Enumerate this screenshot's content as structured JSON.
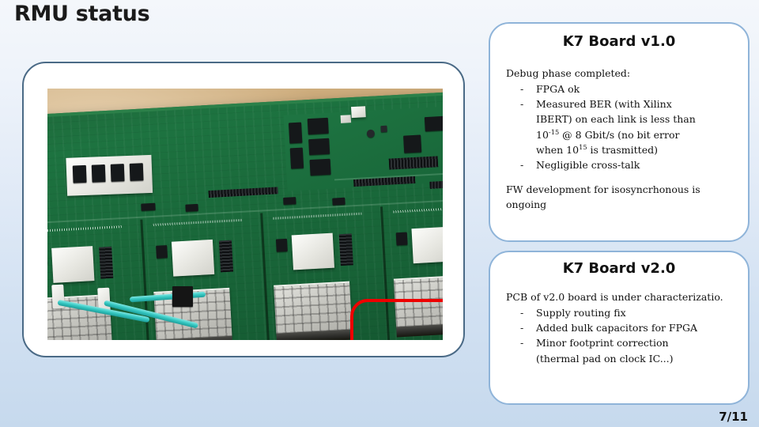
{
  "slide": {
    "title": "RMU status",
    "page_number": "7/11",
    "accent_border_left": "#4a6a86",
    "accent_border_right": "#8fb4d9",
    "annotation_color": "#ee0000",
    "background_top": "#f4f7fb",
    "background_bottom": "#c6d9ed"
  },
  "photo": {
    "alt": "Photograph of a green K7 PCB with SFP cages and cyan fiber optic cables on a wooden desk",
    "annotation_name": "red-highlight-box"
  },
  "panel_v1": {
    "heading": "K7 Board v1.0",
    "lead": "Debug phase completed:",
    "bullets": [
      {
        "text": "FPGA ok",
        "continuations": []
      },
      {
        "text": "Measured BER (with Xilinx",
        "continuations": [
          "IBERT) on each link is less than",
          "10-15 @ 8 Gbit/s (no bit error",
          "when 1015 is trasmitted)"
        ]
      },
      {
        "text": "Negligible cross-talk",
        "continuations": []
      }
    ],
    "bullet_rich": {
      "ber_line_prefix": "10",
      "ber_exp_negative": "-15",
      "ber_line_mid": " @ 8 Gbit/s (no bit error",
      "trans_prefix": "when 10",
      "trans_exp": "15",
      "trans_suffix": " is trasmitted)"
    },
    "tail": "FW development for isosyncrhonous is ongoing"
  },
  "panel_v2": {
    "heading": "K7 Board v2.0",
    "lead": "PCB of v2.0 board is under characterizatio.",
    "bullets": [
      {
        "text": "Supply routing fix",
        "continuations": []
      },
      {
        "text": "Added bulk capacitors for FPGA",
        "continuations": []
      },
      {
        "text": "Minor footprint correction",
        "continuations": [
          "(thermal pad on clock IC...)"
        ]
      }
    ]
  }
}
